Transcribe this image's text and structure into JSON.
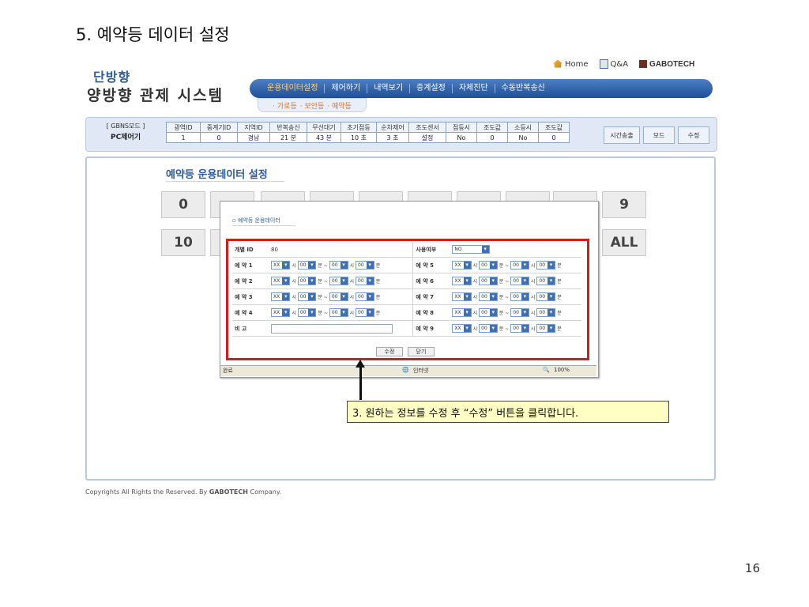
{
  "slide": {
    "title": "5. 예약등 데이터 설정",
    "page_number": "16",
    "copyright_prefix": "Copyrights All Rights the Reserved. By ",
    "copyright_brand": "GABOTECH",
    "copyright_suffix": " Company."
  },
  "header": {
    "logo_line1": "단방향",
    "logo_line2": "양방향 관제 시스템",
    "links": {
      "home": "Home",
      "qa": "Q&A",
      "brand": "GABOTECH"
    },
    "nav": [
      "운용데이터설정",
      "제어하기",
      "내역보기",
      "중계설정",
      "자체진단",
      "수동반복송신"
    ],
    "subnav": [
      "· 가로등",
      "· 보안등",
      "· 예약등"
    ]
  },
  "status": {
    "mode_label": "[ GBNS모드 ]",
    "mode_value": "PC제어기",
    "headers": [
      "광역ID",
      "중계기ID",
      "지역ID",
      "반복송신",
      "무선대기",
      "초기점등",
      "순차제어",
      "조도센서",
      "점등시",
      "조도값",
      "소등시",
      "조도값"
    ],
    "values": [
      "1",
      "0",
      "경남",
      "21 분",
      "43 분",
      "10 초",
      "3 초",
      "설정",
      "No",
      "0",
      "No",
      "0"
    ],
    "buttons": [
      "시간송출",
      "모드",
      "수정"
    ]
  },
  "content": {
    "section_title": "예약등 운용데이터 설정",
    "group_row1_first": "0",
    "group_row1_last": "9",
    "group_row2_first": "10",
    "group_row2_last": "ALL"
  },
  "popup": {
    "subtitle": "▫ 예약등 운용데이터",
    "group_id_label": "개별 ID",
    "group_id_value": "80",
    "use_label": "사용여부",
    "use_value": "NO",
    "left_rows": [
      "예 약 1",
      "예 약 2",
      "예 약 3",
      "예 약 4"
    ],
    "right_rows": [
      "예 약 5",
      "예 약 6",
      "예 약 7",
      "예 약 8",
      "예 약 9"
    ],
    "memo_label": "비   고",
    "time_default": {
      "a": "XX",
      "b": "00",
      "c": "00",
      "d": "00"
    },
    "units": {
      "hour": "시",
      "min_range": "분 ~",
      "min": "분"
    },
    "buttons": {
      "edit": "수정",
      "close": "닫기"
    },
    "ie_status": {
      "done": "완료",
      "zone": "인터넷",
      "zoom": "100%"
    }
  },
  "callout": "3. 원하는 정보를 수정 후 “수정” 버튼을 클릭합니다."
}
